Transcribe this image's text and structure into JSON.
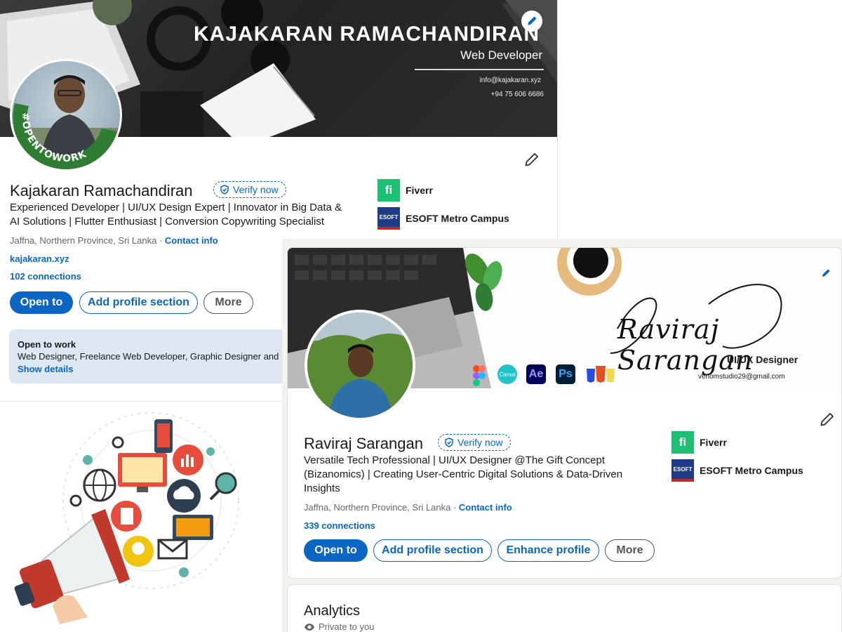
{
  "profile1": {
    "banner": {
      "title": "KAJAKARAN RAMACHANDIRAN",
      "subtitle": "Web Developer",
      "email": "info@kajakaran.xyz",
      "phone": "+94 75 606 6686"
    },
    "open_to_work_frame": "#OPENTOWORK",
    "name": "Kajakaran Ramachandiran",
    "verify_label": "Verify now",
    "headline_line1": "Experienced Developer | UI/UX Design Expert | Innovator in Big Data &",
    "headline_line2": "AI Solutions | Flutter Enthusiast | Conversion Copywriting Specialist",
    "location": "Jaffna, Northern Province, Sri Lanka",
    "separator": "·",
    "contact_info": "Contact info",
    "website": "kajakaran.xyz",
    "connections": "102 connections",
    "buttons": {
      "open_to": "Open to",
      "add_section": "Add profile section",
      "more": "More"
    },
    "companies": [
      {
        "name": "Fiverr",
        "logo": "fi"
      },
      {
        "name": "ESOFT Metro Campus",
        "logo": "ESOFT"
      }
    ],
    "open_to_work": {
      "title": "Open to work",
      "roles": "Web Designer, Freelance Web Developer, Graphic Designer and",
      "show_details": "Show details"
    }
  },
  "profile2": {
    "banner": {
      "script_name": "Raviraj Sarangan",
      "title": "UI/UX Designer",
      "email": "venomstudio29@gmail.com",
      "tool_icons": [
        "Ae",
        "Ps",
        "Canva"
      ]
    },
    "name": "Raviraj Sarangan",
    "verify_label": "Verify now",
    "headline_line1": "Versatile Tech Professional | UI/UX Designer @The Gift Concept",
    "headline_line2": "(Bizanomics) | Creating User-Centric Digital Solutions & Data-Driven",
    "headline_line3": "Insights",
    "location": "Jaffna, Northern Province, Sri Lanka",
    "separator": "·",
    "contact_info": "Contact info",
    "connections": "339 connections",
    "buttons": {
      "open_to": "Open to",
      "add_section": "Add profile section",
      "enhance": "Enhance profile",
      "more": "More"
    },
    "companies": [
      {
        "name": "Fiverr",
        "logo": "fi"
      },
      {
        "name": "ESOFT Metro Campus",
        "logo": "ESOFT"
      }
    ]
  },
  "analytics": {
    "title": "Analytics",
    "private": "Private to you"
  },
  "colors": {
    "accent": "#0a66c2",
    "fiverr": "#1dbf73",
    "otw_green": "#2e7d32",
    "otw_bg": "#dde7f1"
  }
}
